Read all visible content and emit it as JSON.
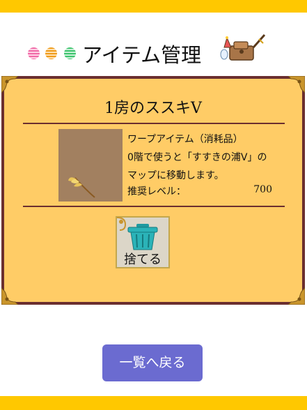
{
  "header": {
    "title": "アイテム管理",
    "dot_colors": [
      "#f06aa8",
      "#ef9c1b",
      "#3ec46e"
    ]
  },
  "item": {
    "name": "1房のススキV",
    "description_lines": [
      "ワープアイテム（消耗品）",
      "0階で使うと「すすきの浦V」の",
      "マップに移動します。"
    ],
    "level_label": "推奨レベル：",
    "level_value": "700"
  },
  "actions": {
    "discard_label": "捨てる",
    "back_label": "一覧へ戻る"
  },
  "colors": {
    "accent_bar": "#ffc800",
    "panel_bg": "#ffcc66",
    "panel_border": "#6b2f2f",
    "back_button": "#6b6bd0"
  }
}
